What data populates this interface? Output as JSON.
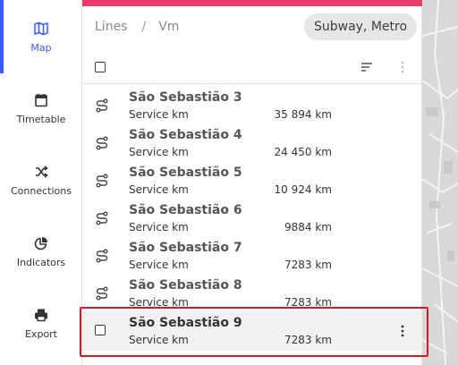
{
  "nav": {
    "items": [
      {
        "label": "Map",
        "icon": "map-icon",
        "active": true
      },
      {
        "label": "Timetable",
        "icon": "calendar-icon",
        "active": false
      },
      {
        "label": "Connections",
        "icon": "shuffle-icon",
        "active": false
      },
      {
        "label": "Indicators",
        "icon": "pie-chart-icon",
        "active": false
      },
      {
        "label": "Export",
        "icon": "printer-icon",
        "active": false
      }
    ]
  },
  "header": {
    "breadcrumb": [
      "Lines",
      "Vm"
    ],
    "mode_chip": "Subway, Metro"
  },
  "list": {
    "rows": [
      {
        "name": "São Sebastião 3",
        "metric": "Service km",
        "value": "35 894 km",
        "icon": "line-route-icon"
      },
      {
        "name": "São Sebastião 4",
        "metric": "Service km",
        "value": "24 450 km",
        "icon": "line-route-icon"
      },
      {
        "name": "São Sebastião 5",
        "metric": "Service km",
        "value": "10 924 km",
        "icon": "line-route-icon"
      },
      {
        "name": "São Sebastião 6",
        "metric": "Service km",
        "value": "9884 km",
        "icon": "line-route-icon"
      },
      {
        "name": "São Sebastião 7",
        "metric": "Service km",
        "value": "7283 km",
        "icon": "line-route-icon"
      },
      {
        "name": "São Sebastião 8",
        "metric": "Service km",
        "value": "7283 km",
        "icon": "line-route-icon"
      },
      {
        "name": "São Sebastião 9",
        "metric": "Service km",
        "value": "7283 km",
        "icon": "checkbox",
        "selected": true
      }
    ]
  },
  "colors": {
    "accent": "#3d5afe",
    "top_bar": "#ec3b6a",
    "highlight": "#d61a2a"
  }
}
